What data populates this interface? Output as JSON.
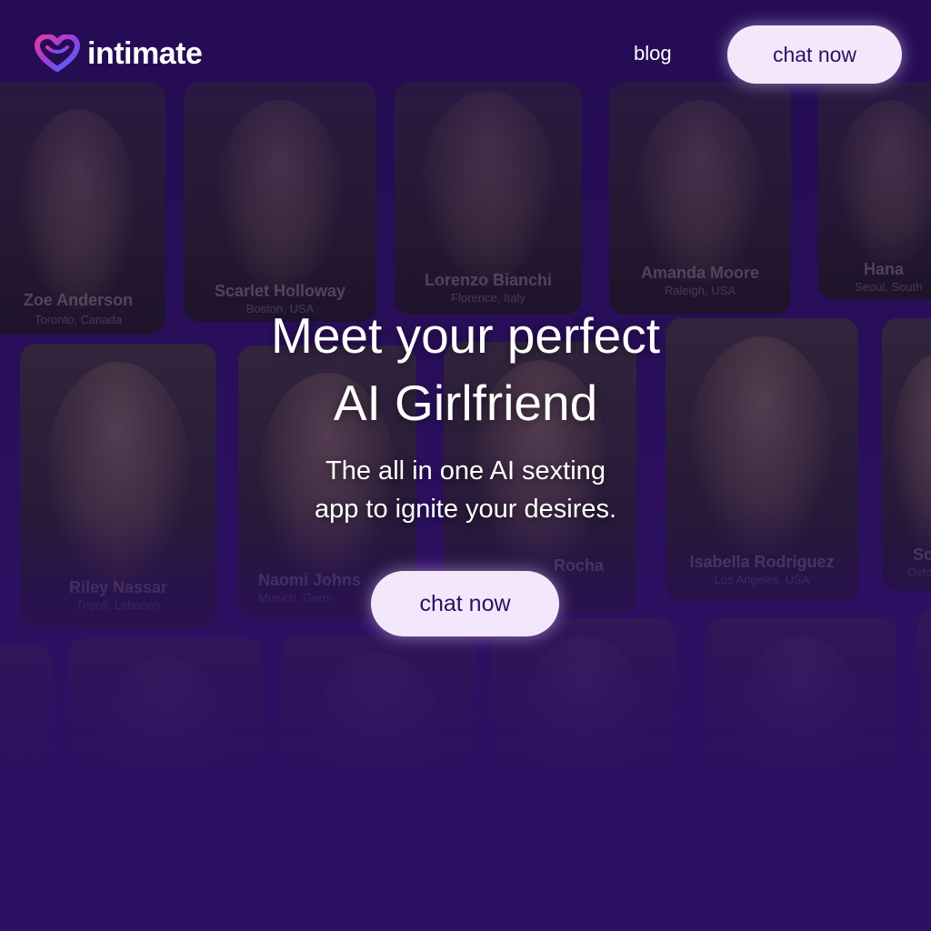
{
  "brand": {
    "name": "intimate",
    "logo_icon": "heart-icon",
    "colors": {
      "accent_start": "#e33aa0",
      "accent_end": "#3d6bff",
      "background": "#2e1062",
      "button_bg": "#f3e8fb",
      "button_text": "#2b1060"
    }
  },
  "nav": {
    "blog_label": "blog",
    "cta_label": "chat now"
  },
  "hero": {
    "title_line1": "Meet your perfect",
    "title_line2": "AI Girlfriend",
    "subtitle_line1": "The all in one AI sexting",
    "subtitle_line2": "app to ignite your desires.",
    "cta_label": "chat now"
  },
  "profiles": [
    {
      "name": "Zoe Anderson",
      "location": "Toronto, Canada"
    },
    {
      "name": "Scarlet Holloway",
      "location": "Boston, USA"
    },
    {
      "name": "Lorenzo Bianchi",
      "location": "Florence, Italy"
    },
    {
      "name": "Amanda Moore",
      "location": "Raleigh, USA"
    },
    {
      "name": "Hana",
      "location": "Seoul, South"
    },
    {
      "name": "Riley Nassar",
      "location": "Tripoli, Lebanon"
    },
    {
      "name": "Naomi Johns",
      "location": "Munich, Germ"
    },
    {
      "name": "Rocha",
      "location": ""
    },
    {
      "name": "Isabella Rodriguez",
      "location": "Los Angeles, USA"
    },
    {
      "name": "So",
      "location": "Oxford"
    }
  ]
}
